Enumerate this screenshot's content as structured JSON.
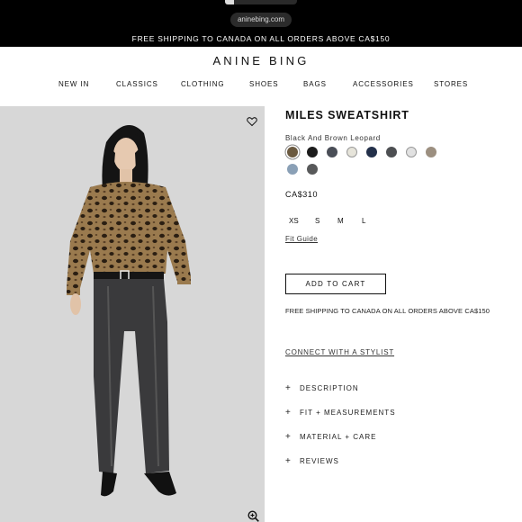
{
  "browser": {
    "url": "aninebing.com"
  },
  "announcement": "FREE SHIPPING TO CANADA ON ALL ORDERS ABOVE CA$150",
  "brand": "ANINE BING",
  "nav": [
    "NEW IN",
    "CLASSICS",
    "CLOTHING",
    "SHOES",
    "BAGS",
    "ACCESSORIES",
    "STORES"
  ],
  "product": {
    "title": "MILES SWEATSHIRT",
    "color_name": "Black And Brown Leopard",
    "swatches": [
      "#6b5a40",
      "#1c1c1c",
      "#4a4e57",
      "#e6e4da",
      "#23304a",
      "#4d4f52",
      "#e1e1e1",
      "#9c8f80",
      "#8aa0b6",
      "#58595a"
    ],
    "price": "CA$310",
    "sizes": [
      "XS",
      "S",
      "M",
      "L"
    ],
    "fit_guide": "Fit Guide",
    "add_to_cart": "ADD TO CART",
    "shipping_note": "FREE SHIPPING TO CANADA ON ALL ORDERS ABOVE CA$150",
    "stylist_link": "CONNECT WITH A STYLIST",
    "accordions": [
      "DESCRIPTION",
      "FIT + MEASUREMENTS",
      "MATERIAL + CARE",
      "REVIEWS"
    ]
  },
  "icons": {
    "wishlist": "heart-icon",
    "zoom": "zoom-in-icon",
    "expand": "plus-icon"
  }
}
